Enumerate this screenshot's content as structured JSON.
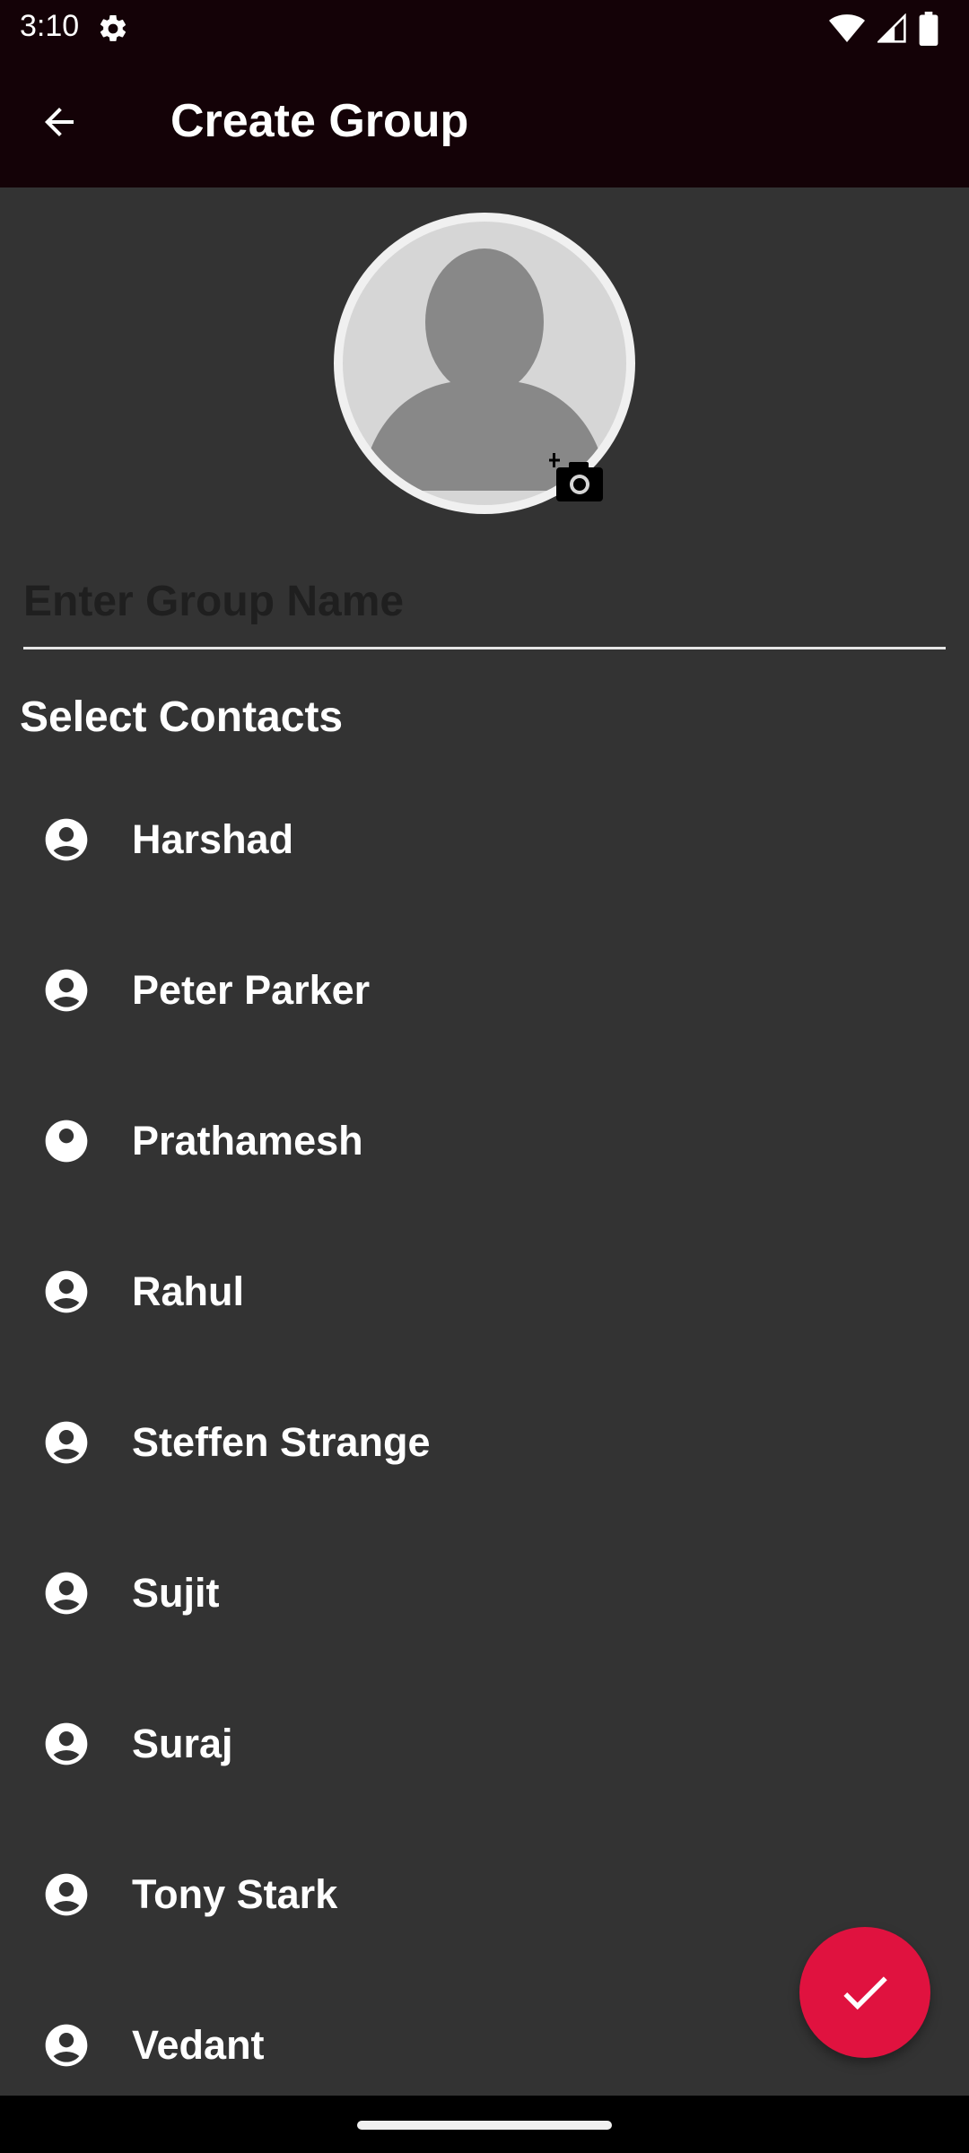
{
  "status_bar": {
    "time": "3:10",
    "icons": [
      "settings-gear-icon",
      "wifi-icon",
      "signal-icon",
      "battery-icon"
    ]
  },
  "app_bar": {
    "title": "Create Group",
    "back_icon": "arrow-back-icon"
  },
  "avatar": {
    "icon": "default-person-avatar",
    "camera_icon": "add-photo-camera-icon"
  },
  "group_name": {
    "placeholder": "Enter Group Name",
    "value": ""
  },
  "contacts_section": {
    "title": "Select Contacts",
    "items": [
      {
        "name": "Harshad",
        "icon": "account-circle-icon"
      },
      {
        "name": "Peter Parker",
        "icon": "account-circle-icon"
      },
      {
        "name": "Prathamesh",
        "icon": "account-circle-icon"
      },
      {
        "name": "Rahul",
        "icon": "account-circle-icon"
      },
      {
        "name": "Steffen Strange",
        "icon": "account-circle-icon"
      },
      {
        "name": "Sujit",
        "icon": "account-circle-icon"
      },
      {
        "name": "Suraj",
        "icon": "account-circle-icon"
      },
      {
        "name": "Tony Stark",
        "icon": "account-circle-icon"
      },
      {
        "name": "Vedant",
        "icon": "account-circle-icon"
      }
    ]
  },
  "fab": {
    "icon": "check-icon"
  },
  "colors": {
    "app_bar": "#140207",
    "background": "#333333",
    "fab": "#e0123f",
    "text": "#ffffff"
  }
}
